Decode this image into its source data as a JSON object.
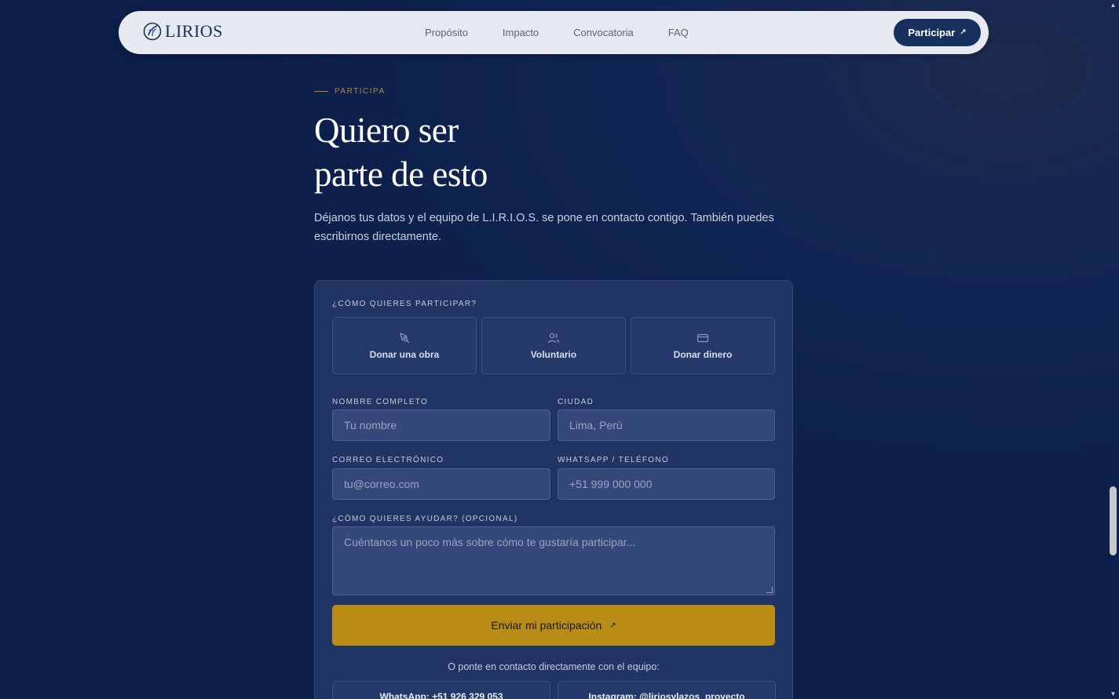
{
  "nav": {
    "logo_text": "LIRIOS",
    "links": [
      "Propósito",
      "Impacto",
      "Convocatoria",
      "FAQ"
    ],
    "cta_label": "Participar",
    "cta_arrow": "↗"
  },
  "hero": {
    "eyebrow": "PARTICIPA",
    "title_line1": "Quiero ser",
    "title_line2": "parte de esto",
    "lead": "Déjanos tus datos y el equipo de L.I.R.I.O.S. se pone en contacto contigo. También puedes escribirnos directamente."
  },
  "form": {
    "participation_label": "¿CÓMO QUIERES PARTICIPAR?",
    "options": [
      {
        "label": "Donar una obra",
        "icon": "brush-icon"
      },
      {
        "label": "Voluntario",
        "icon": "users-icon"
      },
      {
        "label": "Donar dinero",
        "icon": "credit-card-icon"
      }
    ],
    "name_label": "NOMBRE COMPLETO",
    "name_placeholder": "Tu nombre",
    "city_label": "CIUDAD",
    "city_placeholder": "Lima, Perú",
    "email_label": "CORREO ELECTRÓNICO",
    "email_placeholder": "tu@correo.com",
    "phone_label": "WHATSAPP / TELÉFONO",
    "phone_placeholder": "+51 999 000 000",
    "help_label": "¿CÓMO QUIERES AYUDAR? (OPCIONAL)",
    "help_placeholder": "Cuéntanos un poco más sobre cómo te gustaría participar...",
    "submit_label": "Enviar mi participación",
    "submit_arrow": "↗",
    "contact_note": "O ponte en contacto directamente con el equipo:",
    "whatsapp_label": "WhatsApp: +51 926 329 053",
    "instagram_label": "Instagram: @liriosylazos_proyecto"
  },
  "colors": {
    "background": "#0c1f4a",
    "nav_background": "#e6e9ef",
    "brand_navy": "#17305e",
    "accent_gold": "#b98c16"
  }
}
